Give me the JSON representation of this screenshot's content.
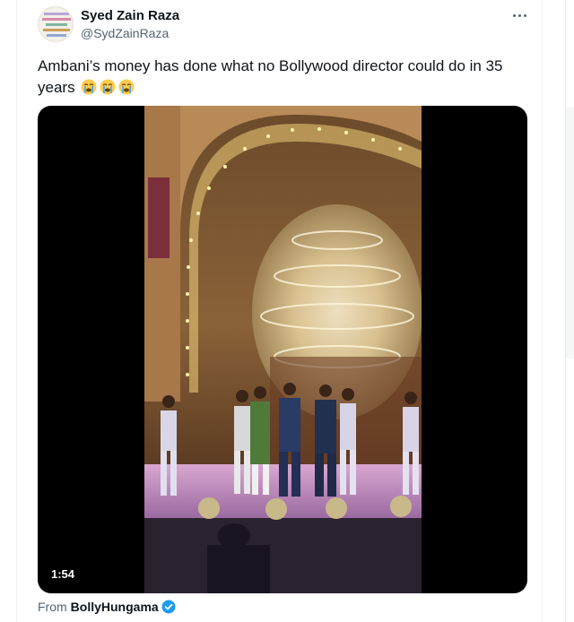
{
  "tweet": {
    "author_name": "Syed Zain Raza",
    "author_handle": "@SydZainRaza",
    "text_line": "Ambani’s money has done what no Bollywood director could do in 35 years",
    "emojis": [
      "loudly-crying-face",
      "loudly-crying-face",
      "loudly-crying-face"
    ]
  },
  "media": {
    "duration": "1:54"
  },
  "attribution": {
    "from_label": "From",
    "source_name": "BollyHungama"
  },
  "colors": {
    "text": "#0f1419",
    "secondary": "#536471",
    "verified": "#1d9bf0",
    "media_bg": "#000000"
  }
}
